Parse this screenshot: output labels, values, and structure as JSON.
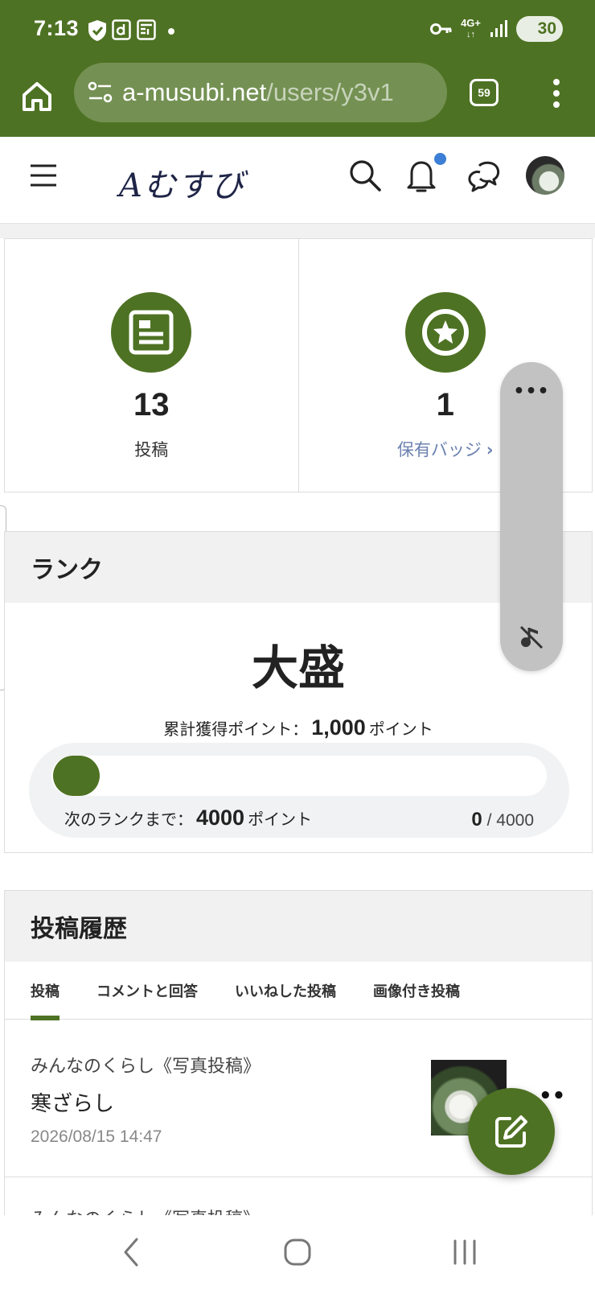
{
  "status_bar": {
    "time": "7:13",
    "network": "4G+",
    "battery": "30",
    "icons": [
      "shield-icon",
      "d-app-icon",
      "newspaper-icon",
      "dot-icon",
      "key-icon",
      "network-4g-icon",
      "signal-icon",
      "battery-icon"
    ]
  },
  "browser": {
    "url_host": "a-musubi.net",
    "url_path": "/users/y3v1",
    "tab_count": "59"
  },
  "header": {
    "logo": "Aむすび",
    "icons": [
      "menu-icon",
      "search-icon",
      "bell-icon",
      "chat-icon",
      "avatar"
    ]
  },
  "stats": {
    "posts": {
      "count": "13",
      "label": "投稿"
    },
    "badges": {
      "count": "1",
      "label": "保有バッジ",
      "chevron": "›"
    }
  },
  "floating_pill": {
    "dots": "•••"
  },
  "rank": {
    "heading": "ランク",
    "name": "大盛",
    "total_label": "累計獲得ポイント：",
    "total_value": "1,000",
    "total_unit": "ポイント",
    "next_label": "次のランクまで：",
    "next_value": "4000",
    "next_unit": "ポイント",
    "progress_current": "0",
    "progress_separator": "/",
    "progress_max": "4000",
    "progress_fraction": 0.0
  },
  "history": {
    "heading": "投稿履歴",
    "tabs": [
      "投稿",
      "コメントと回答",
      "いいねした投稿",
      "画像付き投稿"
    ],
    "active_tab": 0,
    "posts": [
      {
        "category": "みんなのくらし《写真投稿》",
        "title": "寒ざらし",
        "date": "2026/08/15 14:47",
        "more": "••"
      },
      {
        "category": "みんなのくらし《写真投稿》"
      }
    ]
  },
  "colors": {
    "brand_green": "#4e7223",
    "link_blue": "#6c82b0",
    "notification_dot": "#3d7fd6"
  }
}
